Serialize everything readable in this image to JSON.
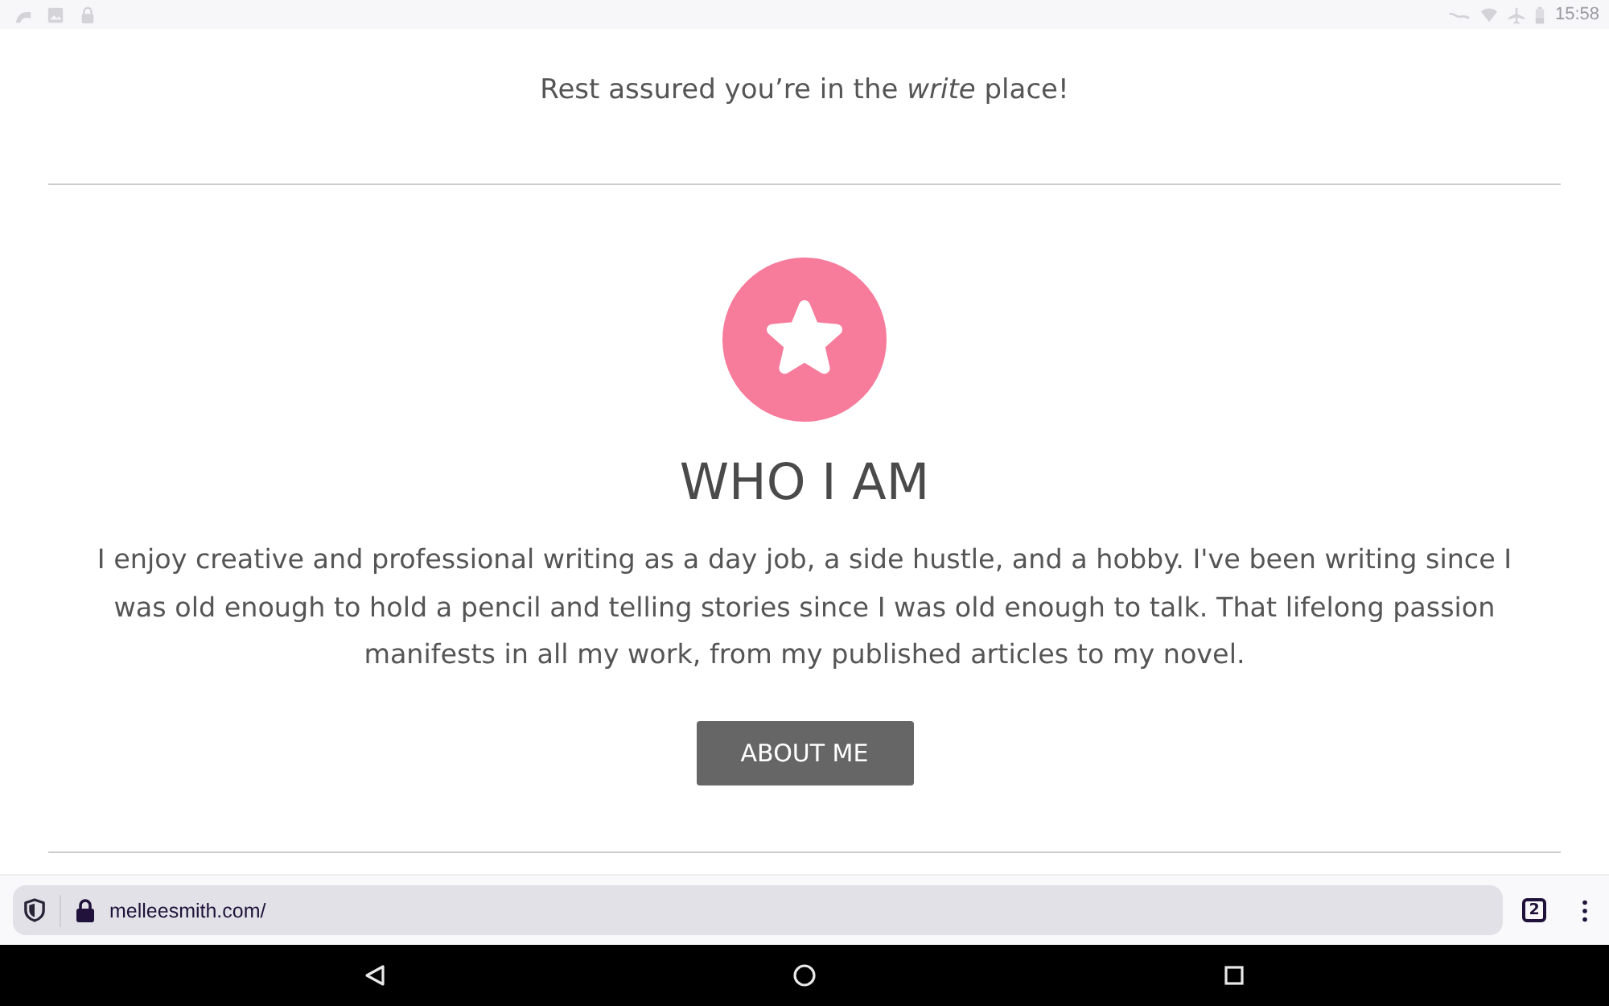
{
  "status_bar": {
    "time": "15:58"
  },
  "page": {
    "tagline": "Rest assured you’re in the *write* place!",
    "section": {
      "heading": "WHO I AM",
      "body": "I enjoy creative and professional writing as a day job, a side hustle, and a hobby. I've been writing since I was old enough to hold a pencil and telling stories since I was old enough to talk. That lifelong passion manifests in all my work, from my published articles to my novel.",
      "button": "ABOUT ME"
    }
  },
  "browser_bar": {
    "url": "melleesmith.com/",
    "tab_count": "2"
  }
}
